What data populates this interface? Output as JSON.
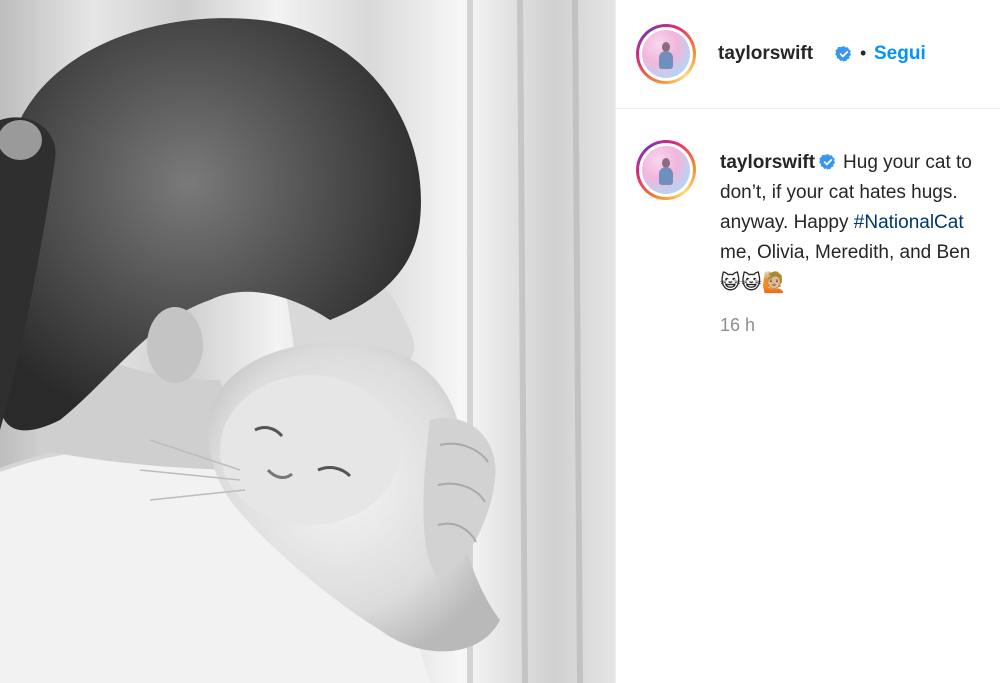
{
  "post": {
    "image_alt": "",
    "author": {
      "username": "taylorswift",
      "verified": true
    },
    "header": {
      "separator": "•",
      "follow_label": "Segui"
    },
    "caption": {
      "username": "taylorswift",
      "line1": "Hug your cat to",
      "line2": "don’t, if your cat hates hugs.",
      "line3_prefix": "anyway. Happy ",
      "hashtag": "#NationalCat",
      "line4": "me, Olivia, Meredith, and Ben",
      "emojis": "😺😺🙋🏼"
    },
    "timestamp": "16 h"
  },
  "colors": {
    "link": "#0095f6",
    "hashtag": "#00376b",
    "verified": "#3897f0",
    "muted": "#8e8e8e"
  },
  "icons": {
    "verified": "verified-badge-icon"
  }
}
